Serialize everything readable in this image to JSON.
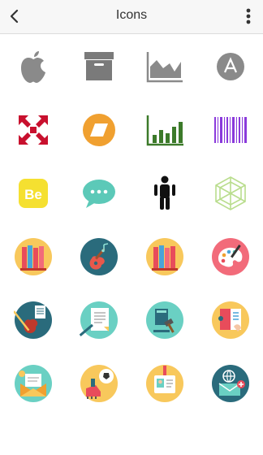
{
  "app_bar": {
    "title": "Icons",
    "back_icon": "chevron-left-icon",
    "menu_icon": "more-vertical-icon"
  },
  "icons": [
    "apple-logo-icon",
    "archive-box-icon",
    "area-chart-icon",
    "angular-logo-icon",
    "expand-arrows-icon",
    "parallelogram-badge-icon",
    "bar-chart-icon",
    "barcode-icon",
    "behance-logo-icon",
    "chat-bubble-icon",
    "child-figure-icon",
    "hexagon-wireframe-icon",
    "bookshelf-badge-icon",
    "guitar-badge-icon",
    "books-badge-icon",
    "paint-palette-badge-icon",
    "violin-sheet-music-badge-icon",
    "document-pen-badge-icon",
    "law-gavel-badge-icon",
    "reading-book-badge-icon",
    "open-envelope-badge-icon",
    "soccer-cleats-badge-icon",
    "id-card-badge-icon",
    "global-mail-badge-icon"
  ],
  "colors": {
    "gray_icon": "#8a8a8a",
    "red": "#c8102e",
    "orange": "#f0a030",
    "green": "#3c7a2a",
    "purple": "#8a3adb",
    "yellow": "#f5e030",
    "teal": "#5cc9b8",
    "light_green": "#b9dd8d",
    "badge_yellow": "#f8c85c",
    "badge_dark_teal": "#2a6b7c",
    "badge_pink": "#f26b7a",
    "badge_mint": "#6ad0c3"
  }
}
